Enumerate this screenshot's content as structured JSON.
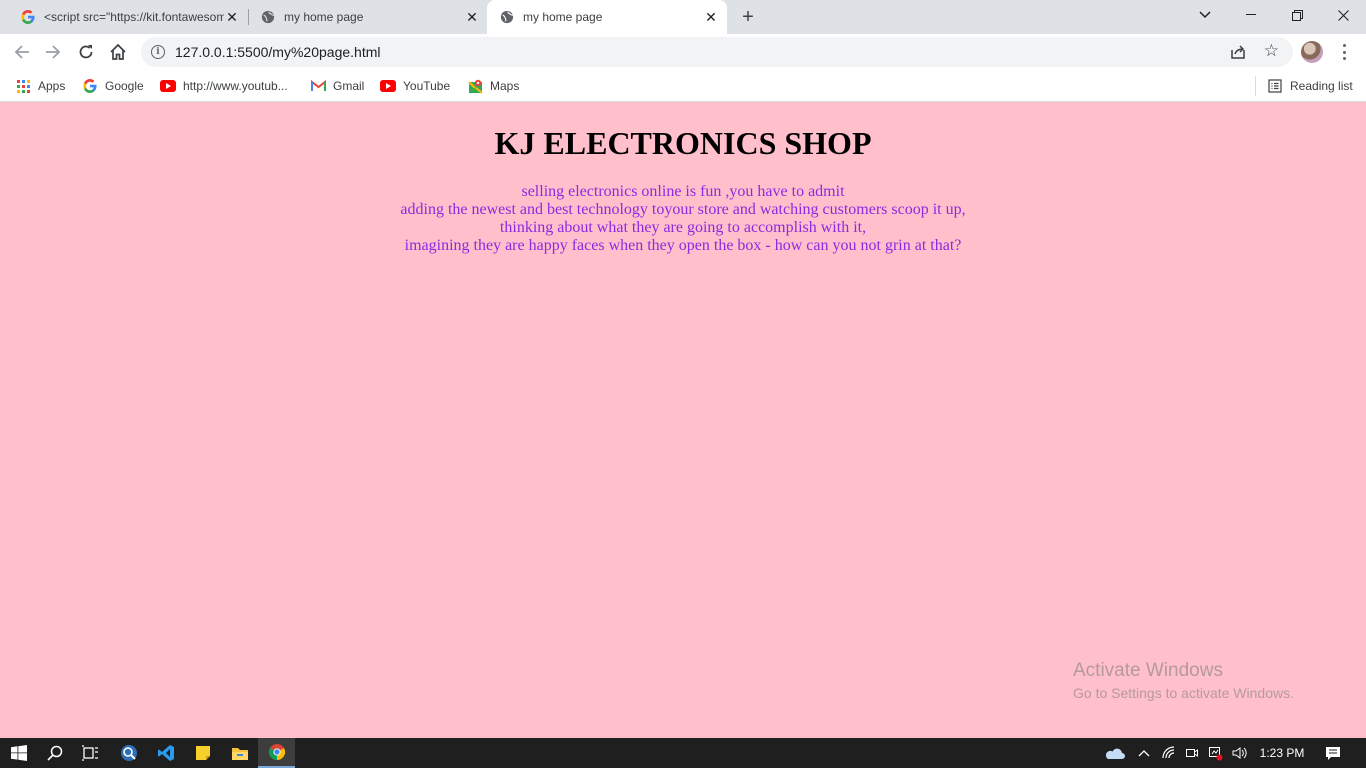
{
  "browser": {
    "tabs": [
      {
        "title": "<script src=\"https://kit.fontawesome",
        "favicon": "google-icon",
        "active": false
      },
      {
        "title": "my home page",
        "favicon": "globe-icon",
        "active": false
      },
      {
        "title": "my home page",
        "favicon": "globe-icon",
        "active": true
      }
    ],
    "address": "127.0.0.1:5500/my%20page.html",
    "bookmarks": {
      "apps": "Apps",
      "google": "Google",
      "youtube_url": "http://www.youtub...",
      "gmail": "Gmail",
      "youtube": "YouTube",
      "maps": "Maps"
    },
    "reading_list": "Reading list"
  },
  "page": {
    "heading": "KJ ELECTRONICS SHOP",
    "lines": [
      "selling electronics online is fun ,you have to admit",
      "adding the newest and best technology toyour store and watching customers scoop it up,",
      "thinking about what they are going to accomplish with it,",
      "imagining they are happy faces when they open the box - how can you not grin at that?"
    ],
    "heading_color": "#000000",
    "text_color": "#8a2be2",
    "background_color": "#ffc0cb"
  },
  "watermark": {
    "line1": "Activate Windows",
    "line2": "Go to Settings to activate Windows."
  },
  "taskbar": {
    "time": "1:23 PM",
    "apps": [
      "windows-start-icon",
      "search-icon",
      "task-view-icon",
      "app-icon",
      "vscode-icon",
      "sticky-notes-icon",
      "file-explorer-icon",
      "chrome-icon"
    ]
  }
}
